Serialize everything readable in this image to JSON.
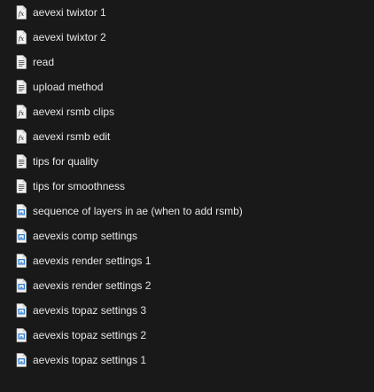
{
  "files": [
    {
      "name": "aevexi twixtor 1",
      "icon": "effect-preset-icon"
    },
    {
      "name": "aevexi twixtor 2",
      "icon": "effect-preset-icon"
    },
    {
      "name": "read",
      "icon": "text-document-icon"
    },
    {
      "name": "upload method",
      "icon": "text-document-icon"
    },
    {
      "name": "aevexi rsmb clips",
      "icon": "effect-preset-icon"
    },
    {
      "name": "aevexi rsmb edit",
      "icon": "effect-preset-icon"
    },
    {
      "name": "tips for quality",
      "icon": "text-document-icon"
    },
    {
      "name": "tips for smoothness",
      "icon": "text-document-icon"
    },
    {
      "name": "sequence of layers in ae (when to add rsmb)",
      "icon": "image-file-icon"
    },
    {
      "name": "aevexis comp settings",
      "icon": "image-file-icon"
    },
    {
      "name": "aevexis render settings 1",
      "icon": "image-file-icon"
    },
    {
      "name": "aevexis render settings 2",
      "icon": "image-file-icon"
    },
    {
      "name": "aevexis topaz settings 3",
      "icon": "image-file-icon"
    },
    {
      "name": "aevexis topaz settings 2",
      "icon": "image-file-icon"
    },
    {
      "name": "aevexis topaz settings 1",
      "icon": "image-file-icon"
    }
  ],
  "colors": {
    "background": "#191919",
    "text": "#e6e6e6",
    "document": "#f2f2f2",
    "image_accent": "#2f7fd6"
  }
}
